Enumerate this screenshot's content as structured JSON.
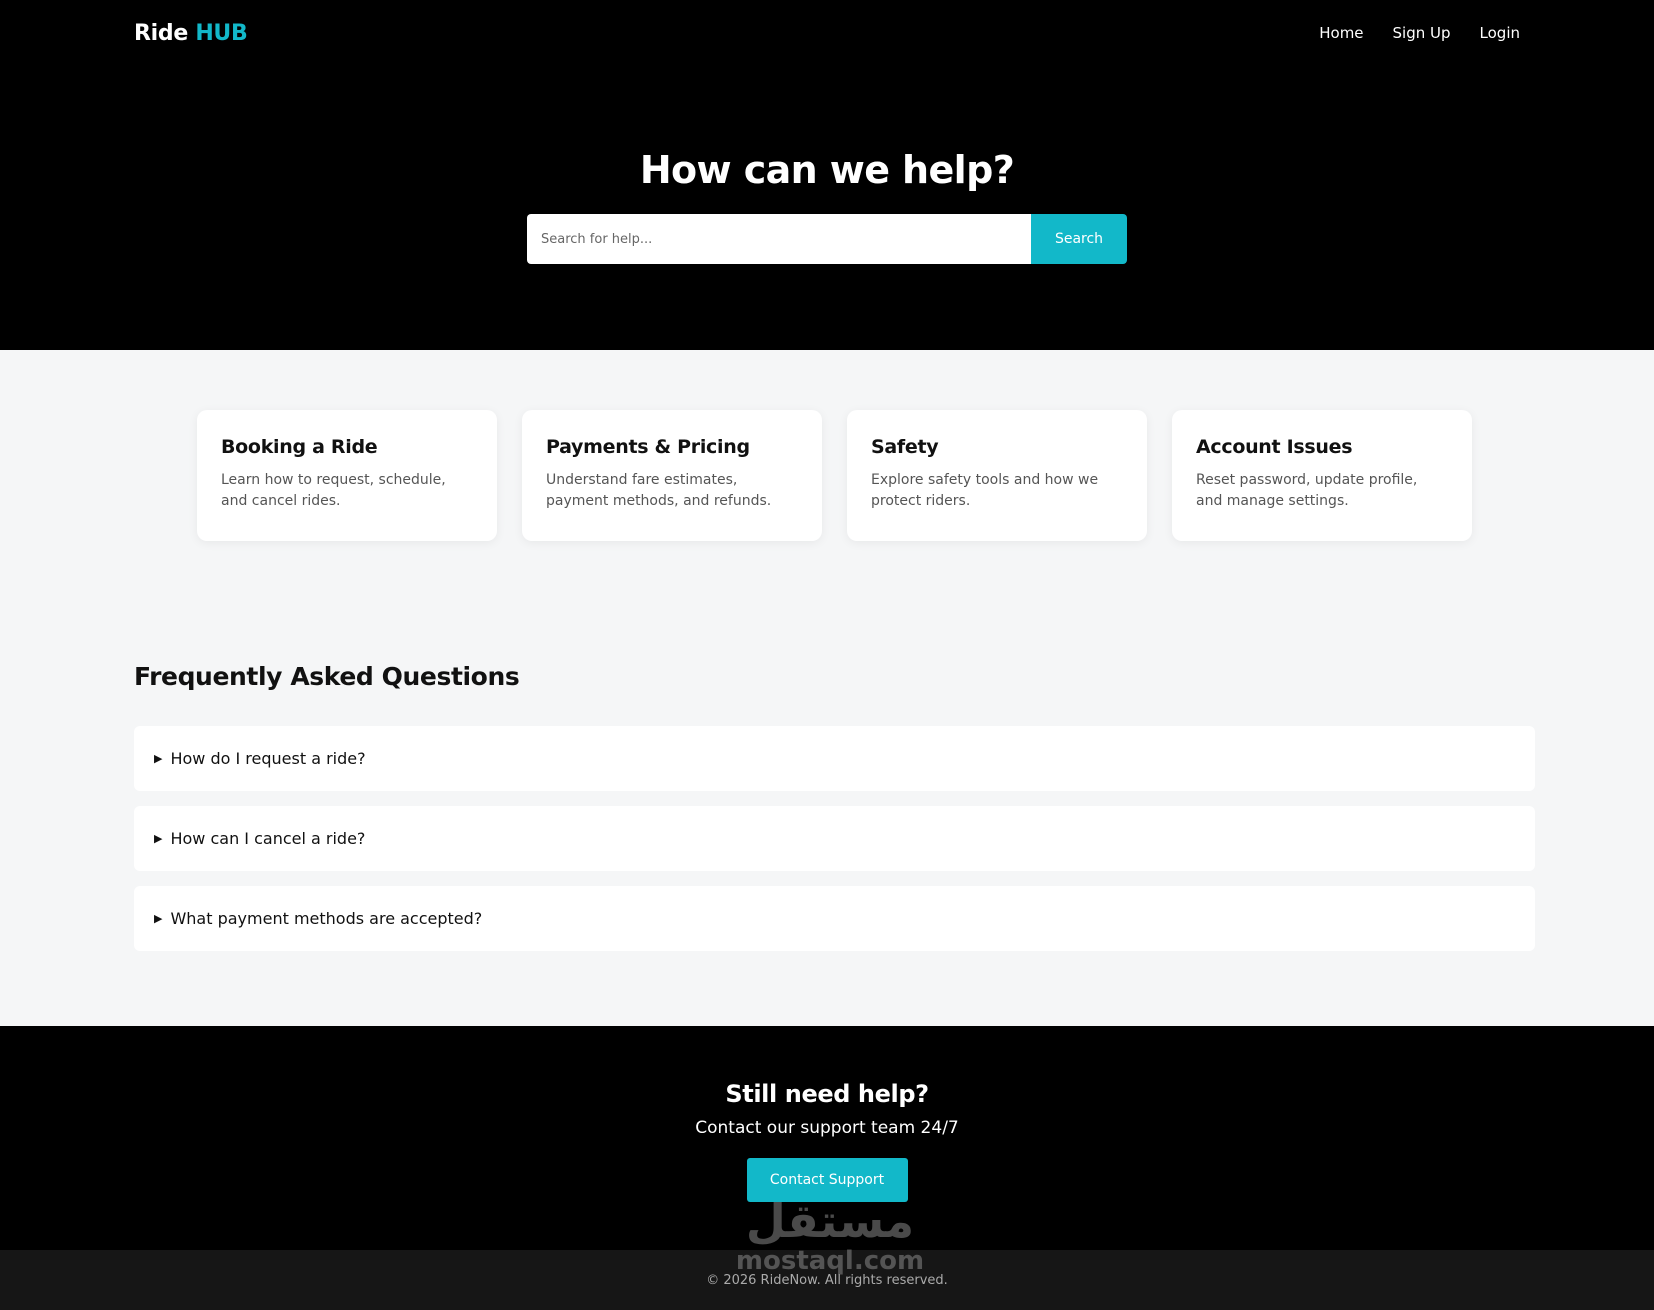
{
  "nav": {
    "logo_main": "Ride",
    "logo_accent": "HUB",
    "links": [
      "Home",
      "Sign Up",
      "Login"
    ]
  },
  "hero": {
    "title": "How can we help?",
    "search_placeholder": "Search for help...",
    "search_button": "Search"
  },
  "categories": [
    {
      "title": "Booking a Ride",
      "desc": "Learn how to request, schedule, and cancel rides."
    },
    {
      "title": "Payments & Pricing",
      "desc": "Understand fare estimates, payment methods, and refunds."
    },
    {
      "title": "Safety",
      "desc": "Explore safety tools and how we protect riders."
    },
    {
      "title": "Account Issues",
      "desc": "Reset password, update profile, and manage settings."
    }
  ],
  "faq": {
    "heading": "Frequently Asked Questions",
    "arrow": "▶",
    "items": [
      "How do I request a ride?",
      "How can I cancel a ride?",
      "What payment methods are accepted?"
    ]
  },
  "cta": {
    "title": "Still need help?",
    "subtitle": "Contact our support team 24/7",
    "button": "Contact Support"
  },
  "footer": {
    "text": "© 2026 RideNow. All rights reserved."
  },
  "watermark": {
    "arabic": "مستقل",
    "latin": "mostaql.com"
  },
  "colors": {
    "accent": "#12b8c9",
    "dark": "#000000",
    "page_bg": "#f5f6f7"
  }
}
